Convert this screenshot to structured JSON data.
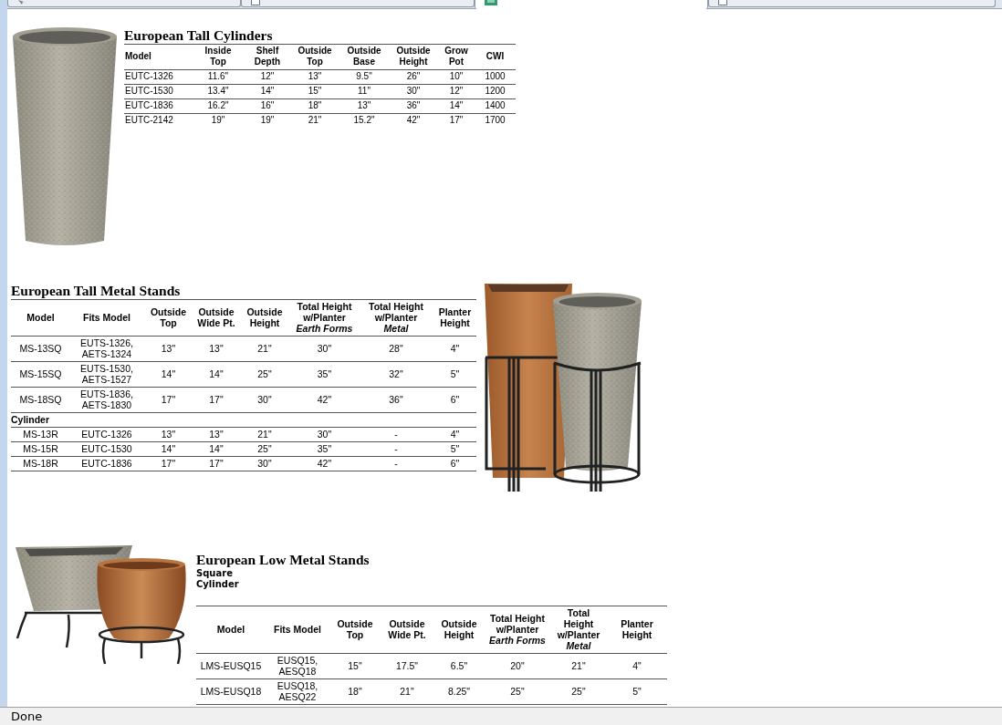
{
  "browser_tabs": [
    {
      "kind": "arrow",
      "selected": false
    },
    {
      "kind": "page",
      "selected": false
    },
    {
      "kind": "square",
      "selected": true
    },
    {
      "kind": "page",
      "selected": false
    }
  ],
  "sections": [
    {
      "kind": "tall-cylinders",
      "title": "European Tall Cylinders",
      "table": {
        "columns": [
          {
            "lines": [
              "Model"
            ]
          },
          {
            "lines": [
              "Inside",
              "Top"
            ]
          },
          {
            "lines": [
              "Shelf",
              "Depth"
            ]
          },
          {
            "lines": [
              "Outside",
              "Top"
            ]
          },
          {
            "lines": [
              "Outside",
              "Base"
            ]
          },
          {
            "lines": [
              "Outside",
              "Height"
            ]
          },
          {
            "lines": [
              "Grow",
              "Pot"
            ]
          },
          {
            "lines": [
              "CWI"
            ]
          }
        ],
        "rows": [
          {
            "kind": "data",
            "cells": [
              "EUTC-1326",
              "11.6\"",
              "12\"",
              "13\"",
              "9.5\"",
              "26\"",
              "10\"",
              "1000"
            ]
          },
          {
            "kind": "data",
            "cells": [
              "EUTC-1530",
              "13.4\"",
              "14\"",
              "15\"",
              "11\"",
              "30\"",
              "12\"",
              "1200"
            ]
          },
          {
            "kind": "data",
            "cells": [
              "EUTC-1836",
              "16.2\"",
              "16\"",
              "18\"",
              "13\"",
              "36\"",
              "14\"",
              "1400"
            ]
          },
          {
            "kind": "data",
            "cells": [
              "EUTC-2142",
              "19\"",
              "19\"",
              "21\"",
              "15.2\"",
              "42\"",
              "17\"",
              "1700"
            ]
          }
        ]
      }
    },
    {
      "kind": "tall-stands",
      "title": "European Tall Metal Stands",
      "table": {
        "columns": [
          {
            "lines": [
              "Model"
            ]
          },
          {
            "lines": [
              "Fits Model"
            ]
          },
          {
            "lines": [
              "Outside",
              "Top"
            ]
          },
          {
            "lines": [
              "Outside",
              "Wide Pt."
            ]
          },
          {
            "lines": [
              "Outside",
              "Height"
            ]
          },
          {
            "lines": [
              "Total Height",
              "w/Planter",
              "*Earth Forms*"
            ]
          },
          {
            "lines": [
              "Total Height",
              "w/Planter",
              "*Metal*"
            ]
          },
          {
            "lines": [
              "Planter",
              "Height"
            ]
          }
        ],
        "rows": [
          {
            "kind": "data",
            "cells": [
              "MS-13SQ",
              "EUTS-1326, AETS-1324",
              "13\"",
              "13\"",
              "21\"",
              "30\"",
              "28\"",
              "4\""
            ]
          },
          {
            "kind": "data",
            "cells": [
              "MS-15SQ",
              "EUTS-1530, AETS-1527",
              "14\"",
              "14\"",
              "25\"",
              "35\"",
              "32\"",
              "5\""
            ]
          },
          {
            "kind": "data",
            "cells": [
              "MS-18SQ",
              "EUTS-1836, AETS-1830",
              "17\"",
              "17\"",
              "30\"",
              "42\"",
              "36\"",
              "6\""
            ]
          },
          {
            "kind": "group",
            "label": "Cylinder"
          },
          {
            "kind": "data",
            "cells": [
              "MS-13R",
              "EUTC-1326",
              "13\"",
              "13\"",
              "21\"",
              "30\"",
              "-",
              "4\""
            ]
          },
          {
            "kind": "data",
            "cells": [
              "MS-15R",
              "EUTC-1530",
              "14\"",
              "14\"",
              "25\"",
              "35\"",
              "-",
              "5\""
            ]
          },
          {
            "kind": "data",
            "cells": [
              "MS-18R",
              "EUTC-1836",
              "17\"",
              "17\"",
              "30\"",
              "42\"",
              "-",
              "6\""
            ]
          }
        ]
      }
    },
    {
      "kind": "low-stands",
      "title": "European Low Metal Stands",
      "subtitles": [
        "Square",
        "Cylinder"
      ],
      "table": {
        "columns": [
          {
            "lines": [
              "Model"
            ]
          },
          {
            "lines": [
              "Fits Model"
            ]
          },
          {
            "lines": [
              "Outside",
              "Top"
            ]
          },
          {
            "lines": [
              "Outside",
              "Wide Pt."
            ]
          },
          {
            "lines": [
              "Outside",
              "Height"
            ]
          },
          {
            "lines": [
              "Total Height",
              "w/Planter",
              "*Earth Forms*"
            ]
          },
          {
            "lines": [
              "Total",
              "Height",
              "w/Planter",
              "*Metal*"
            ]
          },
          {
            "lines": [
              "Planter",
              "Height"
            ]
          }
        ],
        "rows": [
          {
            "kind": "data",
            "cells": [
              "LMS-EUSQ15",
              "EUSQ15, AESQ18",
              "15\"",
              "17.5\"",
              "6.5\"",
              "20\"",
              "21\"",
              "4\""
            ]
          },
          {
            "kind": "data",
            "cells": [
              "LMS-EUSQ18",
              "EUSQ18, AESQ22",
              "18\"",
              "21\"",
              "8.25\"",
              "25\"",
              "25\"",
              "5\""
            ]
          }
        ]
      }
    }
  ],
  "status_bar": {
    "text": "Done"
  }
}
